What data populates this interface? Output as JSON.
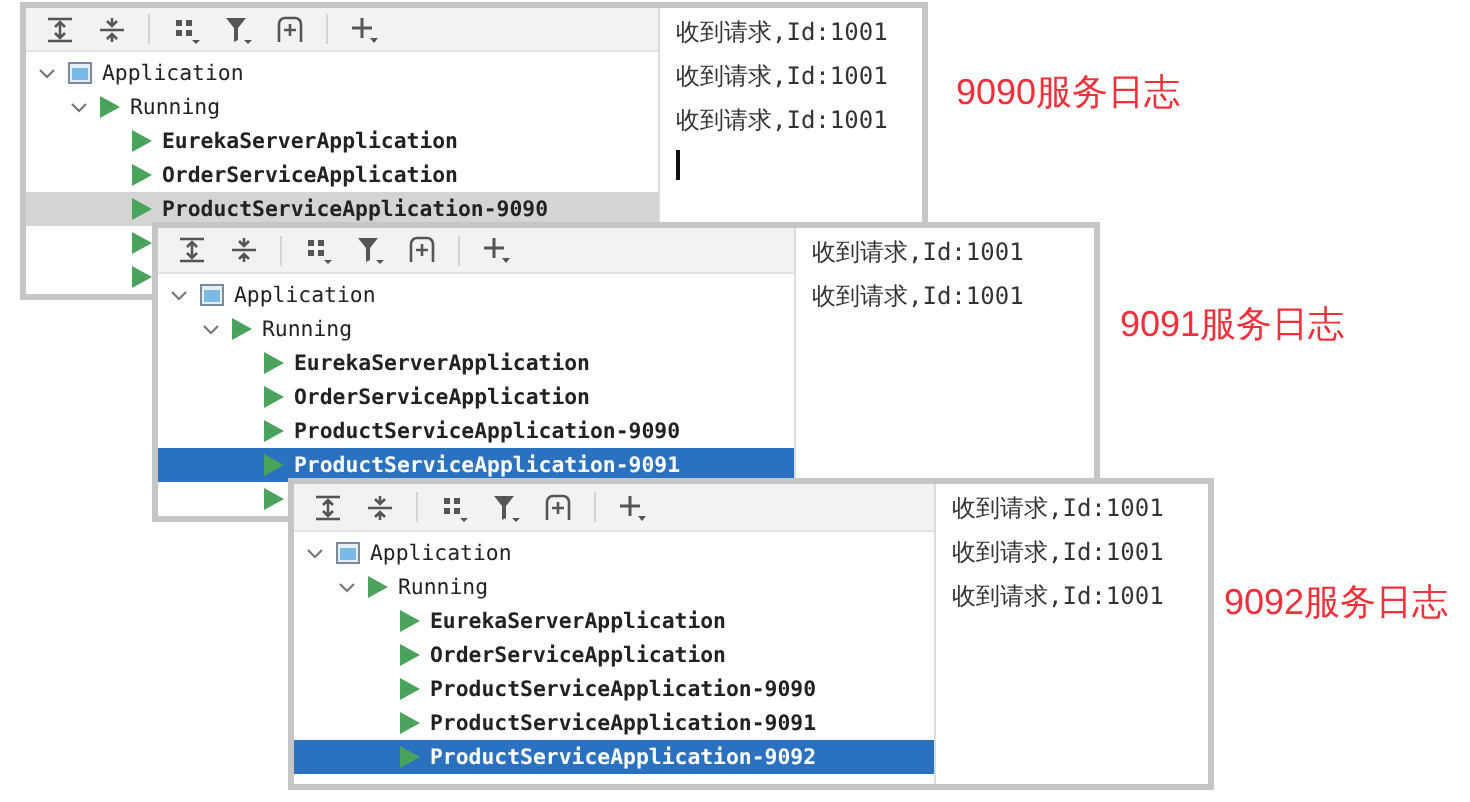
{
  "windows": [
    {
      "tree_focused": false,
      "tree": [
        {
          "label": "Application",
          "expanded": true,
          "selected": false,
          "children": [
            {
              "label": "Running",
              "expanded": true,
              "selected": false,
              "children": [
                {
                  "label": "EurekaServerApplication",
                  "selected": false
                },
                {
                  "label": "OrderServiceApplication",
                  "selected": false
                },
                {
                  "label": "ProductServiceApplication-9090",
                  "selected": true
                },
                {
                  "selected": false
                },
                {
                  "selected": false
                }
              ]
            }
          ]
        }
      ],
      "log_lines": [
        "收到请求,Id:1001",
        "收到请求,Id:1001",
        "收到请求,Id:1001"
      ],
      "cursor": true,
      "caption": "9090服务日志"
    },
    {
      "tree_focused": true,
      "tree": [
        {
          "label": "Application",
          "expanded": true,
          "selected": false,
          "children": [
            {
              "label": "Running",
              "expanded": true,
              "selected": false,
              "children": [
                {
                  "label": "EurekaServerApplication",
                  "selected": false
                },
                {
                  "label": "OrderServiceApplication",
                  "selected": false
                },
                {
                  "label": "ProductServiceApplication-9090",
                  "selected": false
                },
                {
                  "label": "ProductServiceApplication-9091",
                  "selected": true
                },
                {
                  "selected": false
                }
              ]
            }
          ]
        }
      ],
      "log_lines": [
        "收到请求,Id:1001",
        "收到请求,Id:1001"
      ],
      "caption": "9091服务日志"
    },
    {
      "tree_focused": true,
      "tree": [
        {
          "label": "Application",
          "expanded": true,
          "selected": false,
          "children": [
            {
              "label": "Running",
              "expanded": true,
              "selected": false,
              "children": [
                {
                  "label": "EurekaServerApplication",
                  "selected": false
                },
                {
                  "label": "OrderServiceApplication",
                  "selected": false
                },
                {
                  "label": "ProductServiceApplication-9090",
                  "selected": false
                },
                {
                  "label": "ProductServiceApplication-9091",
                  "selected": false
                },
                {
                  "label": "ProductServiceApplication-9092",
                  "selected": true
                }
              ]
            }
          ]
        }
      ],
      "log_lines": [
        "收到请求,Id:1001",
        "收到请求,Id:1001",
        "收到请求,Id:1001"
      ],
      "caption": "9092服务日志"
    }
  ]
}
